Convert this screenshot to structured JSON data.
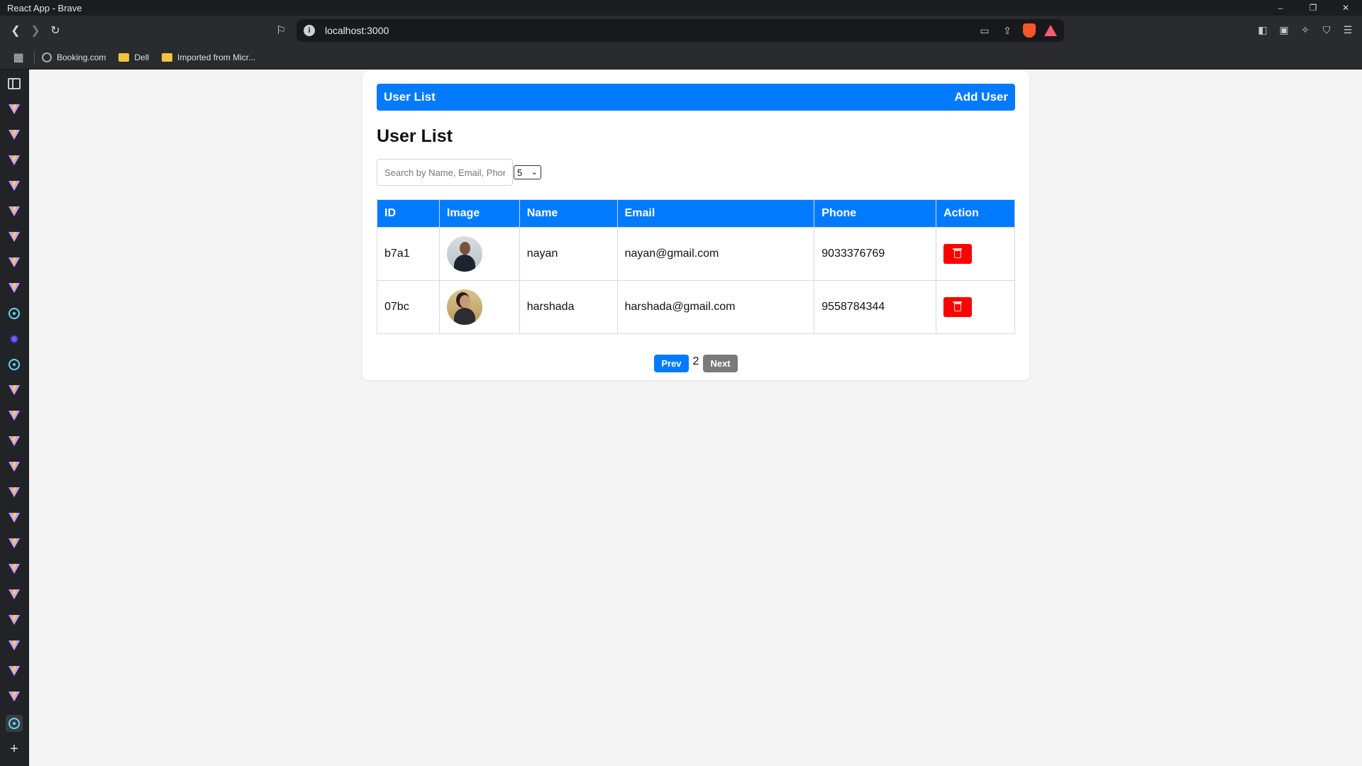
{
  "window": {
    "title": "React App - Brave",
    "controls": [
      "–",
      "❐",
      "✕"
    ]
  },
  "toolbar": {
    "url": "localhost:3000"
  },
  "bookmarks": [
    {
      "label": "Booking.com",
      "icon": "globe-icon"
    },
    {
      "label": "Dell",
      "icon": "folder-icon"
    },
    {
      "label": "Imported from Micr...",
      "icon": "folder-icon"
    }
  ],
  "app": {
    "nav": {
      "left": "User List",
      "right": "Add User"
    },
    "heading": "User List",
    "search": {
      "placeholder": "Search by Name, Email, Phone",
      "value": ""
    },
    "per_page": "5",
    "table": {
      "headers": [
        "ID",
        "Image",
        "Name",
        "Email",
        "Phone",
        "Action"
      ],
      "rows": [
        {
          "id": "b7a1",
          "name": "nayan",
          "email": "nayan@gmail.com",
          "phone": "9033376769"
        },
        {
          "id": "07bc",
          "name": "harshada",
          "email": "harshada@gmail.com",
          "phone": "9558784344"
        }
      ]
    },
    "pagination": {
      "prev": "Prev",
      "current": "2",
      "next": "Next"
    }
  },
  "colors": {
    "primary": "#007bff",
    "danger": "#ff0000",
    "muted": "#7a7a7a"
  }
}
